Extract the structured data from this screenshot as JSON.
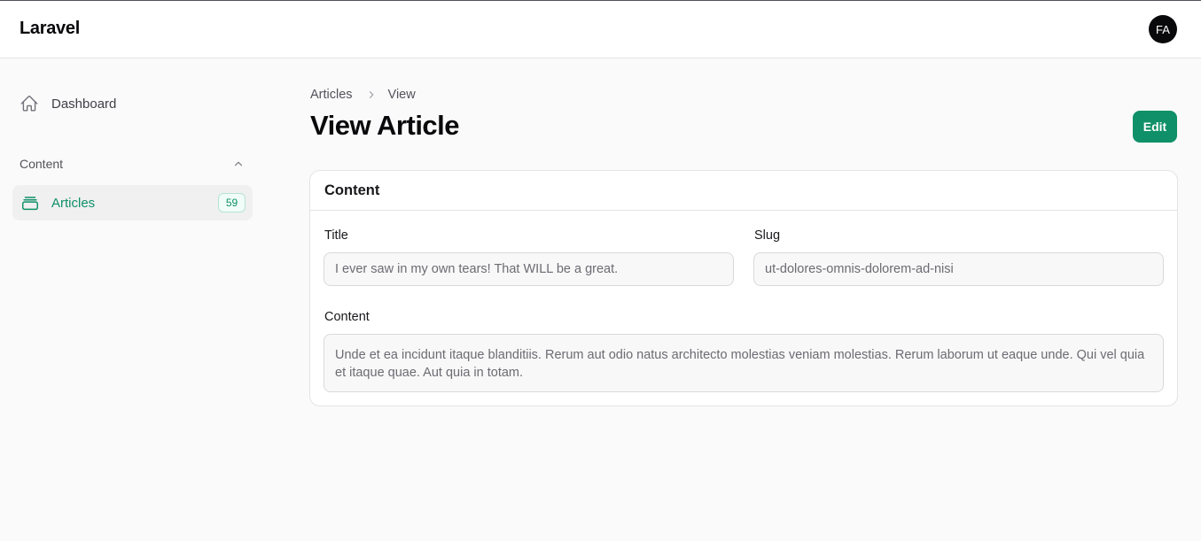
{
  "header": {
    "brand": "Laravel",
    "avatar_initials": "FA"
  },
  "sidebar": {
    "dashboard": {
      "label": "Dashboard",
      "icon": "home-icon"
    },
    "group": {
      "label": "Content",
      "icon": "chevron-up-icon"
    },
    "articles": {
      "label": "Articles",
      "icon": "stack-icon",
      "count": "59",
      "active": true
    }
  },
  "breadcrumb": {
    "items": [
      "Articles",
      "View"
    ],
    "separator_icon": "chevron-right-icon"
  },
  "page": {
    "title": "View Article",
    "edit_label": "Edit"
  },
  "card": {
    "heading": "Content",
    "fields": {
      "title": {
        "label": "Title",
        "value": "I ever saw in my own tears! That WILL be a great."
      },
      "slug": {
        "label": "Slug",
        "value": "ut-dolores-omnis-dolorem-ad-nisi"
      },
      "content": {
        "label": "Content",
        "value": "Unde et ea incidunt itaque blanditiis. Rerum aut odio natus architecto molestias veniam molestias. Rerum laborum ut eaque unde. Qui vel quia et itaque quae. Aut quia in totam."
      }
    }
  },
  "colors": {
    "accent": "#0f9068",
    "background": "#fafafa",
    "text": "#18181b"
  }
}
